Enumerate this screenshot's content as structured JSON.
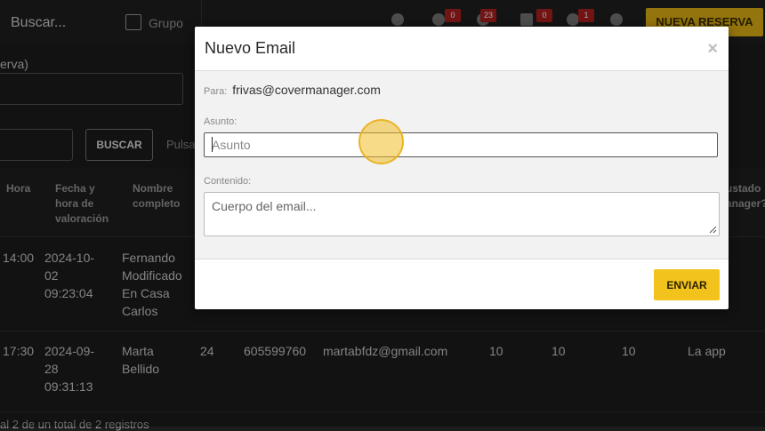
{
  "topbar": {
    "search_placeholder": "Buscar...",
    "grupo_label": "Grupo",
    "badges": [
      "0",
      "23",
      "0",
      "1"
    ],
    "new_reservation_label": "NUEVA RESERVA"
  },
  "filters": {
    "field_label": "erva)",
    "search_button": "BUSCAR",
    "hint": "Pulsa"
  },
  "table": {
    "headers": [
      "Hora",
      "Fecha y hora de valoración",
      "Nombre completo",
      "ustado anager?"
    ],
    "rows": [
      {
        "hora": "14:00",
        "fecha": "2024-10-02 09:23:04",
        "nombre": "Fernando Modificado En Casa Carlos"
      },
      {
        "hora": "17:30",
        "fecha": "2024-09-28 09:31:13",
        "nombre": "Marta Bellido",
        "c1": "24",
        "phone": "605599760",
        "email": "martabfdz@gmail.com",
        "v1": "10",
        "v2": "10",
        "v3": "10",
        "source": "La app"
      }
    ],
    "footer": "al 2 de un total de 2 registros"
  },
  "modal": {
    "title": "Nuevo Email",
    "close": "×",
    "to_label": "Para:",
    "to_value": "frivas@covermanager.com",
    "subject_label": "Asunto:",
    "subject_placeholder": "Asunto",
    "content_label": "Contenido:",
    "content_placeholder": "Cuerpo del email...",
    "send_label": "ENVIAR"
  },
  "colors": {
    "accent": "#f2c31d",
    "badge": "#b02020",
    "background": "#1d1d1d"
  }
}
